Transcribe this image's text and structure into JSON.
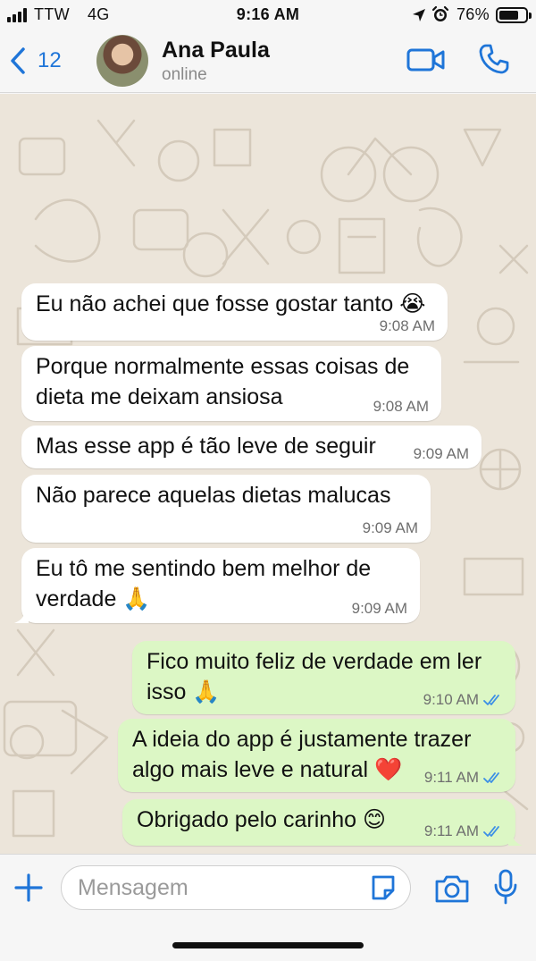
{
  "status_bar": {
    "carrier": "TTW",
    "network": "4G",
    "time": "9:16 AM",
    "battery_percent": "76%",
    "battery_level": 0.76
  },
  "header": {
    "back_count": "12",
    "contact_name": "Ana Paula",
    "contact_status": "online"
  },
  "messages": [
    {
      "direction": "incoming",
      "text": "Eu não achei que fosse gostar tanto 😭",
      "time": "9:08 AM"
    },
    {
      "direction": "incoming",
      "text": "Porque normalmente essas coisas de dieta me deixam ansiosa",
      "time": "9:08 AM"
    },
    {
      "direction": "incoming",
      "text": "Mas esse app é tão leve de seguir",
      "time": "9:09 AM"
    },
    {
      "direction": "incoming",
      "text": "Não parece aquelas dietas malucas",
      "time": "9:09 AM"
    },
    {
      "direction": "incoming",
      "text": "Eu tô me sentindo bem melhor de verdade 🙏",
      "time": "9:09 AM"
    },
    {
      "direction": "outgoing",
      "text": "Fico muito feliz de verdade em ler isso 🙏",
      "time": "9:10 AM",
      "status": "read"
    },
    {
      "direction": "outgoing",
      "text": "A ideia do app é justamente trazer algo mais leve e natural ❤️",
      "time": "9:11 AM",
      "status": "read"
    },
    {
      "direction": "outgoing",
      "text": "Obrigado pelo carinho 😊",
      "time": "9:11 AM",
      "status": "read"
    }
  ],
  "composer": {
    "placeholder": "Mensagem"
  },
  "colors": {
    "accent": "#1f75d8",
    "incoming_bubble": "#ffffff",
    "outgoing_bubble": "#dcf7c5",
    "read_ticks": "#3a8ee6",
    "chat_background": "#ece5da"
  },
  "icons": [
    "signal-icon",
    "location-icon",
    "alarm-icon",
    "battery-icon",
    "back-chevron-icon",
    "video-call-icon",
    "phone-icon",
    "read-ticks-icon",
    "plus-icon",
    "sticker-icon",
    "camera-icon",
    "microphone-icon"
  ]
}
